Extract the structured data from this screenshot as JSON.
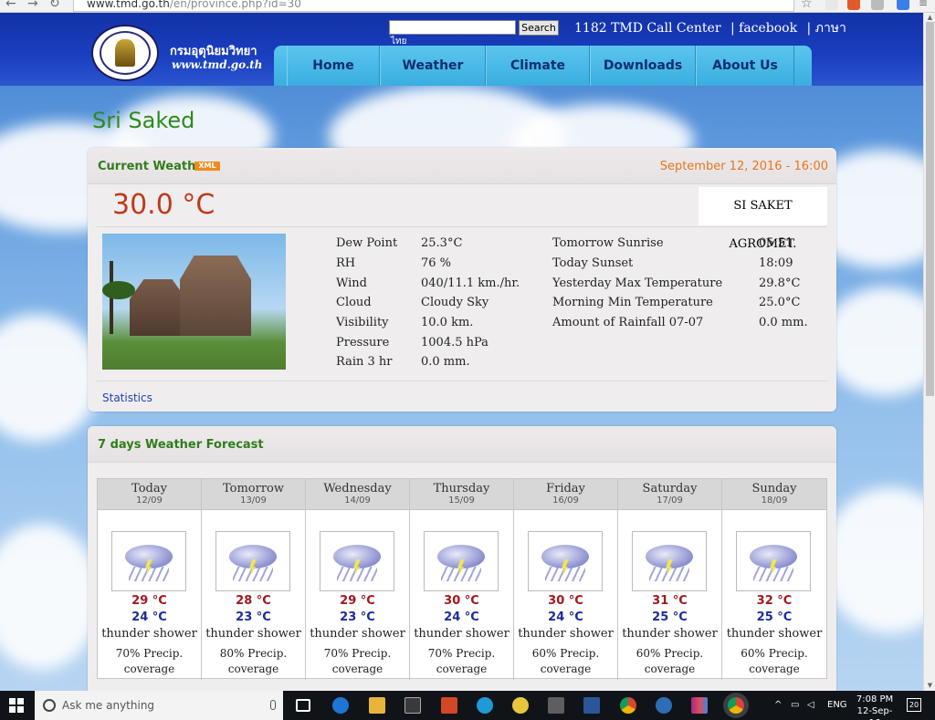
{
  "browser": {
    "url_host": "www.tmd.go.th",
    "url_path": "/en/province.php?id=30"
  },
  "header": {
    "site_name_th": "กรมอุตุนิยมวิทยา",
    "site_url": "www.tmd.go.th",
    "search_button": "Search",
    "lang_th_suffix": "ไทย",
    "call_center": "1182 TMD Call Center",
    "facebook": "| facebook",
    "lang_th": "| ภาษา",
    "menu": [
      "Home",
      "Weather",
      "Climate",
      "Downloads",
      "About Us"
    ]
  },
  "page": {
    "title": "Sri Saked"
  },
  "current": {
    "heading": "Current Weather",
    "xml_badge": "XML",
    "datetime": "September 12, 2016 - 16:00",
    "temperature": "30.0 °C",
    "station": "SI SAKET AGROMET.",
    "left": [
      {
        "label": "Dew Point",
        "value": "25.3°C"
      },
      {
        "label": "RH",
        "value": "76 %"
      },
      {
        "label": "Wind",
        "value": "040/11.1 km./hr."
      },
      {
        "label": "Cloud",
        "value": "Cloudy Sky"
      },
      {
        "label": "Visibility",
        "value": "10.0 km."
      },
      {
        "label": "Pressure",
        "value": "1004.5 hPa"
      },
      {
        "label": "Rain 3 hr",
        "value": "0.0 mm."
      }
    ],
    "right": [
      {
        "label": "Tomorrow Sunrise",
        "value": "05:51"
      },
      {
        "label": "Today Sunset",
        "value": "18:09"
      },
      {
        "label": "Yesterday Max Temperature",
        "value": "29.8°C"
      },
      {
        "label": "Morning Min Temperature",
        "value": "25.0°C"
      },
      {
        "label": "Amount of Rainfall 07-07",
        "value": "0.0 mm."
      }
    ],
    "statistics_link": "Statistics"
  },
  "forecast": {
    "heading": "7 days Weather Forecast",
    "days": [
      {
        "day": "Today",
        "date": "12/09",
        "hi": "29 °C",
        "lo": "24 °C",
        "desc": "thunder shower",
        "precip_line1": "70% Precip.",
        "precip_line2": "coverage"
      },
      {
        "day": "Tomorrow",
        "date": "13/09",
        "hi": "28 °C",
        "lo": "23 °C",
        "desc": "thunder shower",
        "precip_line1": "80% Precip.",
        "precip_line2": "coverage"
      },
      {
        "day": "Wednesday",
        "date": "14/09",
        "hi": "29 °C",
        "lo": "23 °C",
        "desc": "thunder shower",
        "precip_line1": "70% Precip.",
        "precip_line2": "coverage"
      },
      {
        "day": "Thursday",
        "date": "15/09",
        "hi": "30 °C",
        "lo": "24 °C",
        "desc": "thunder shower",
        "precip_line1": "70% Precip.",
        "precip_line2": "coverage"
      },
      {
        "day": "Friday",
        "date": "16/09",
        "hi": "30 °C",
        "lo": "24 °C",
        "desc": "thunder shower",
        "precip_line1": "60% Precip.",
        "precip_line2": "coverage"
      },
      {
        "day": "Saturday",
        "date": "17/09",
        "hi": "31 °C",
        "lo": "25 °C",
        "desc": "thunder shower",
        "precip_line1": "60% Precip.",
        "precip_line2": "coverage"
      },
      {
        "day": "Sunday",
        "date": "18/09",
        "hi": "32 °C",
        "lo": "25 °C",
        "desc": "thunder shower",
        "precip_line1": "60% Precip.",
        "precip_line2": "coverage"
      }
    ]
  },
  "taskbar": {
    "search_placeholder": "Ask me anything",
    "lang": "ENG",
    "time": "7:08 PM",
    "date": "12-Sep-16",
    "notifications": "20"
  },
  "colors": {
    "title_green": "#2f8a1e",
    "date_orange": "#e8761c",
    "temp_red": "#c0391a",
    "hi_red": "#a3181e",
    "lo_blue": "#1c2d97",
    "menu_blue": "#3aaee0"
  }
}
